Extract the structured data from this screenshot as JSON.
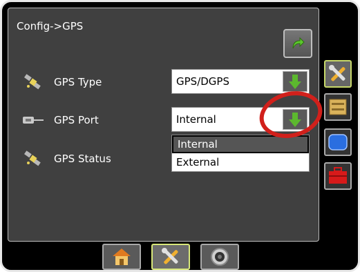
{
  "screen": {
    "title": "Config->GPS"
  },
  "rows": [
    {
      "label": "GPS Type"
    },
    {
      "label": "GPS Port"
    },
    {
      "label": "GPS Status"
    }
  ],
  "gps_type": {
    "value": "GPS/DGPS"
  },
  "gps_port": {
    "value": "Internal",
    "options": [
      "Internal",
      "External"
    ]
  },
  "colors": {
    "accent_green": "#5cb82e",
    "highlight_ring": "#d1201b",
    "toolbox_red": "#d71a1a",
    "blue_key": "#2a6ee0"
  }
}
